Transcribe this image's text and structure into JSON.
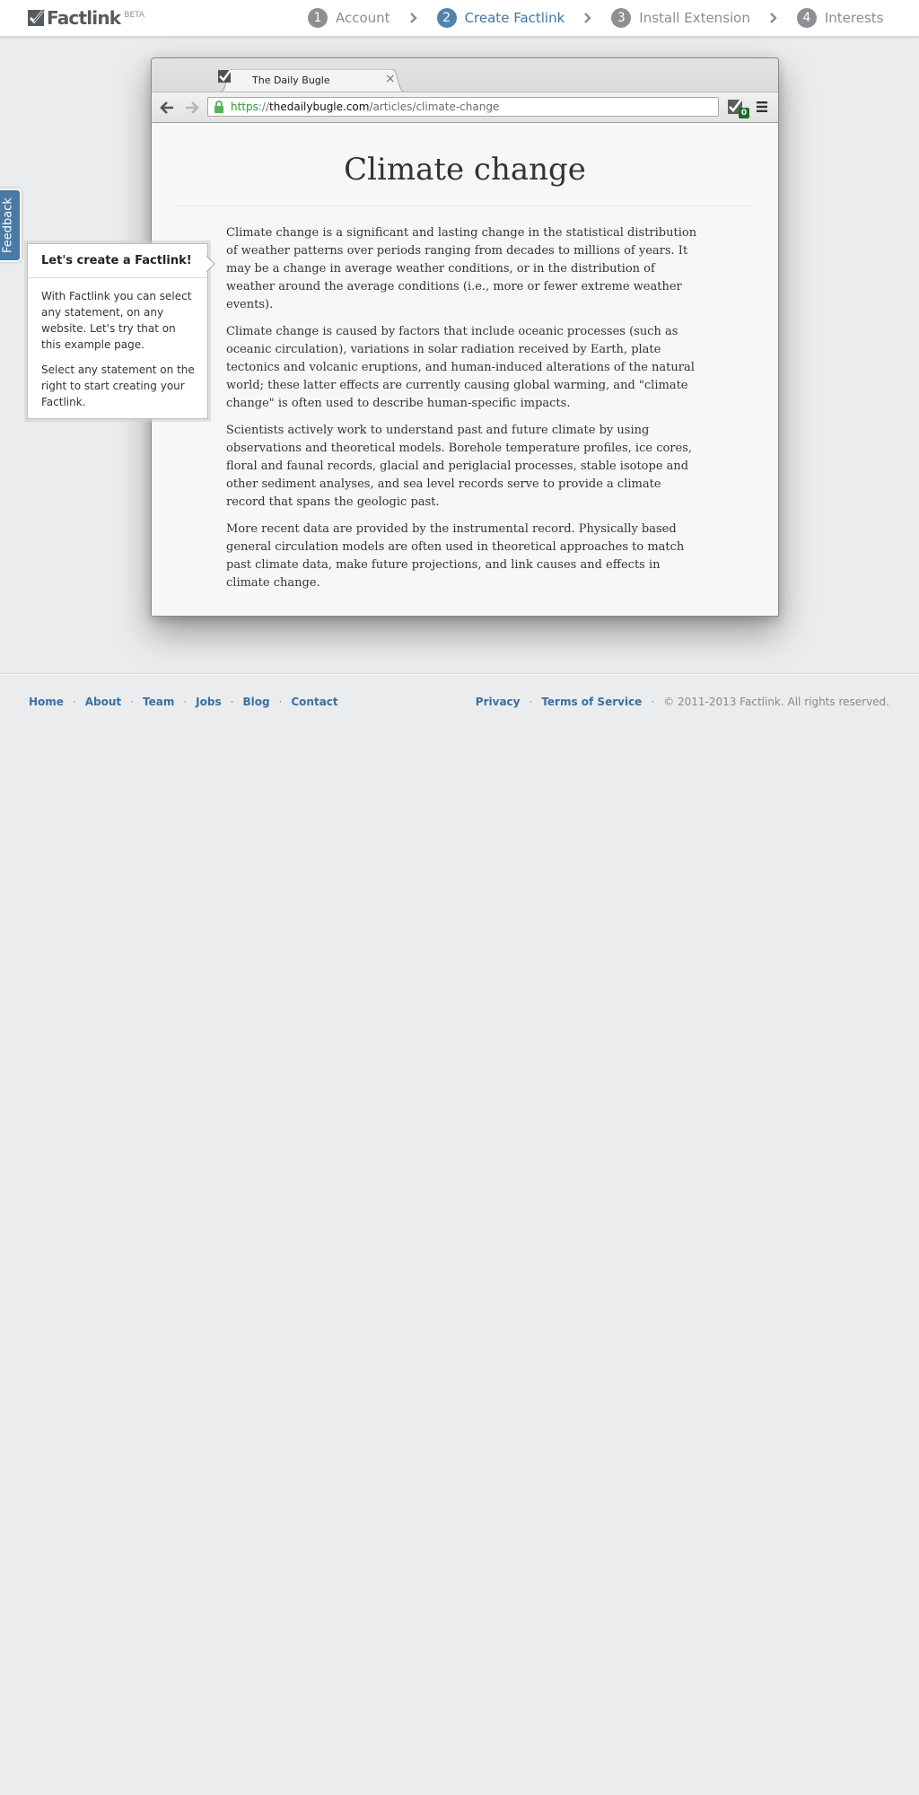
{
  "brand": {
    "name": "Factlink",
    "beta": "BETA"
  },
  "steps": [
    {
      "num": "1",
      "label": "Account",
      "active": false
    },
    {
      "num": "2",
      "label": "Create Factlink",
      "active": true
    },
    {
      "num": "3",
      "label": "Install Extension",
      "active": false
    },
    {
      "num": "4",
      "label": "Interests",
      "active": false
    }
  ],
  "feedback_label": "Feedback",
  "browser": {
    "tab_title": "The Daily Bugle",
    "tab_close": "×",
    "url": {
      "scheme": "https",
      "separator": "://",
      "host": "thedailybugle.com",
      "path": "/articles/climate-change"
    },
    "extension_badge": "0"
  },
  "article": {
    "title": "Climate change",
    "paragraphs": [
      "Climate change is a significant and lasting change in the statistical distribution of weather patterns over periods ranging from decades to millions of years. It may be a change in average weather conditions, or in the distribution of weather around the average conditions (i.e., more or fewer extreme weather events).",
      "Climate change is caused by factors that include oceanic processes (such as oceanic circulation), variations in solar radiation received by Earth, plate tectonics and volcanic eruptions, and human-induced alterations of the natural world; these latter effects are currently causing global warming, and \"climate change\" is often used to describe human-specific impacts.",
      "Scientists actively work to understand past and future climate by using observations and theoretical models. Borehole temperature profiles, ice cores, floral and faunal records, glacial and periglacial processes, stable isotope and other sediment analyses, and sea level records serve to provide a climate record that spans the geologic past.",
      "More recent data are provided by the instrumental record. Physically based general circulation models are often used in theoretical approaches to match past climate data, make future projections, and link causes and effects in climate change."
    ]
  },
  "popover": {
    "title": "Let's create a Factlink!",
    "paragraphs": [
      "With Factlink you can select any statement, on any website. Let's try that on this example page.",
      "Select any statement on the right to start creating your Factlink."
    ]
  },
  "footer": {
    "left_links": [
      "Home",
      "About",
      "Team",
      "Jobs",
      "Blog",
      "Contact"
    ],
    "right_links": [
      "Privacy",
      "Terms of Service"
    ],
    "separator": "·",
    "copyright": "© 2011-2013 Factlink. All rights reserved."
  },
  "colors": {
    "accent": "#3f77a8",
    "step_active": "#5383ab",
    "step_inactive": "#8d8f92",
    "page_bg": "#ebecee",
    "footer_link": "#3a6fa3",
    "url_scheme": "#2a9b2a"
  },
  "icons": {
    "logo": "factlink-check-logo-icon",
    "step_arrow": "chevron-right-icon",
    "back": "arrow-left-icon",
    "forward": "arrow-right-icon",
    "lock": "lock-icon",
    "extension": "factlink-extension-icon",
    "menu": "hamburger-menu-icon",
    "tab_favicon": "factlink-favicon-icon",
    "tab_close": "close-icon"
  }
}
